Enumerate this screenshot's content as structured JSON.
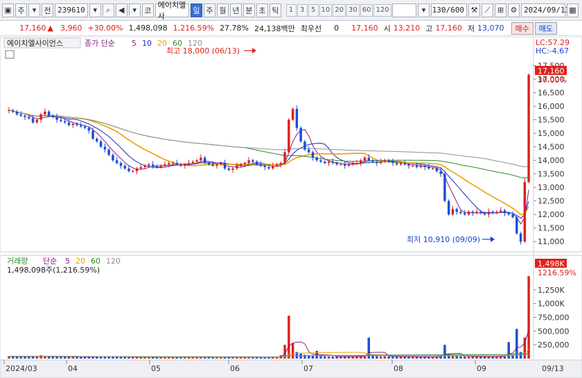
{
  "toolbar": {
    "market": "주",
    "period_btn": "전",
    "code": "239610",
    "stock_name": "에이치엘사",
    "prefix": "코",
    "tabs": [
      "일",
      "주",
      "월",
      "년",
      "분",
      "초",
      "틱"
    ],
    "active_tab": "일",
    "intervals": [
      "1",
      "3",
      "5",
      "10",
      "20",
      "30",
      "60",
      "120"
    ],
    "count": "130/600",
    "date": "2024/09/13"
  },
  "quote": {
    "price": "17,160",
    "change": "3,960",
    "change_pct": "+30.00%",
    "volume": "1,498,098",
    "volume_pct": "1,216.59%",
    "turnover": "27.78%",
    "amount": "24,138백만",
    "priority_label": "최우선",
    "priority_value": "0",
    "ask_price": "17,160",
    "open_label": "시",
    "open": "13,210",
    "high_label": "고",
    "high": "17,160",
    "low_label": "저",
    "low": "13,070",
    "buy_label": "매수",
    "sell_label": "매도"
  },
  "price_panel": {
    "name_tag": "에이치엘사이언스",
    "ma_label": "종가 단순",
    "ma_periods": [
      "5",
      "10",
      "20",
      "60",
      "120"
    ],
    "ma_colors": [
      "#8b1a8b",
      "#1a2bbf",
      "#e8a400",
      "#2a8a2a",
      "#909090"
    ],
    "max_note": "최고 18,000 (06/13)",
    "min_note": "최저 10,910 (09/09)",
    "lc": "LC:57.29",
    "hc": "HC:-4.67",
    "current_tag": "17,160",
    "pct_tag": "30.00%",
    "y_ticks": [
      "17,500",
      "17,000",
      "16,500",
      "16,000",
      "15,500",
      "15,000",
      "14,500",
      "14,000",
      "13,500",
      "13,000",
      "12,500",
      "12,000",
      "11,500",
      "11,000"
    ]
  },
  "volume_panel": {
    "title": "거래량",
    "ma_label": "단순",
    "ma_periods": [
      "5",
      "20",
      "60",
      "120"
    ],
    "ma_colors": [
      "#8b1a8b",
      "#e8a400",
      "#2a8a2a",
      "#909090"
    ],
    "value_note": "1,498,098주(1,216.59%)",
    "current_tag": "1,498K",
    "pct_tag": "1216.59%",
    "y_ticks": [
      "1,250K",
      "1,000K",
      "750,000",
      "500,000",
      "250,000"
    ]
  },
  "x_axis": {
    "ticks": [
      "2024/03",
      "04",
      "05",
      "06",
      "07",
      "08",
      "09"
    ],
    "end_label": "09/13"
  },
  "chart_data": {
    "type": "candlestick",
    "title": "",
    "price_ylim": [
      10750,
      17900
    ],
    "volume_ylim": [
      0,
      1500000
    ],
    "start_index": 0,
    "highlights": [
      {
        "label": "최고",
        "value": 18000,
        "date": "06/13"
      },
      {
        "label": "최저",
        "value": 10910,
        "date": "09/09"
      }
    ],
    "close": [
      15850,
      15800,
      15700,
      15650,
      15600,
      15550,
      15400,
      15500,
      15700,
      15800,
      15650,
      15600,
      15500,
      15450,
      15400,
      15300,
      15350,
      15300,
      15250,
      15200,
      15100,
      14800,
      14700,
      14500,
      14400,
      14200,
      14000,
      13900,
      13800,
      13700,
      13600,
      13600,
      13700,
      13750,
      13800,
      13850,
      13800,
      13750,
      13800,
      13850,
      13900,
      13900,
      13850,
      13800,
      13850,
      13900,
      13950,
      14000,
      14100,
      13900,
      13850,
      13800,
      13850,
      13900,
      13700,
      13650,
      13700,
      13800,
      13850,
      13900,
      14000,
      13950,
      13850,
      13800,
      13750,
      13700,
      13800,
      13850,
      13900,
      14300,
      15500,
      15900,
      15200,
      14700,
      14400,
      14300,
      14100,
      14000,
      13950,
      13900,
      13950,
      13900,
      13850,
      13850,
      13800,
      13850,
      13900,
      13900,
      14000,
      14100,
      14000,
      13950,
      13900,
      13950,
      14000,
      13950,
      13900,
      13850,
      13900,
      13850,
      13800,
      13800,
      13750,
      13800,
      13750,
      13700,
      13700,
      13600,
      13500,
      12500,
      12000,
      12200,
      12100,
      12050,
      12000,
      12100,
      12050,
      12100,
      12050,
      12000,
      12100,
      12050,
      12100,
      12150,
      12050,
      12000,
      11900,
      11300,
      11000,
      13200,
      17160
    ],
    "volume": [
      40000,
      45000,
      38000,
      42000,
      36000,
      40000,
      38000,
      35000,
      60000,
      45000,
      40000,
      38000,
      36000,
      35000,
      34000,
      33000,
      32000,
      30000,
      32000,
      31000,
      35000,
      38000,
      36000,
      40000,
      38000,
      36000,
      34000,
      32000,
      31000,
      30000,
      30000,
      29000,
      28000,
      30000,
      29000,
      28000,
      27000,
      28000,
      27000,
      29000,
      30000,
      28000,
      27000,
      26000,
      28000,
      27000,
      26000,
      30000,
      35000,
      28000,
      27000,
      26000,
      27000,
      28000,
      26000,
      25000,
      26000,
      27000,
      28000,
      27000,
      28000,
      27000,
      26000,
      25000,
      26000,
      27000,
      30000,
      35000,
      60000,
      250000,
      780000,
      280000,
      120000,
      90000,
      70000,
      60000,
      50000,
      140000,
      45000,
      40000,
      38000,
      36000,
      35000,
      34000,
      35000,
      36000,
      37000,
      38000,
      40000,
      42000,
      380000,
      60000,
      45000,
      40000,
      42000,
      38000,
      36000,
      35000,
      36000,
      34000,
      33000,
      32000,
      31000,
      30000,
      31000,
      30000,
      32000,
      36000,
      40000,
      250000,
      80000,
      50000,
      45000,
      40000,
      38000,
      36000,
      35000,
      36000,
      35000,
      34000,
      35000,
      36000,
      38000,
      45000,
      40000,
      300000,
      60000,
      540000,
      120000,
      380000,
      1498098
    ]
  }
}
